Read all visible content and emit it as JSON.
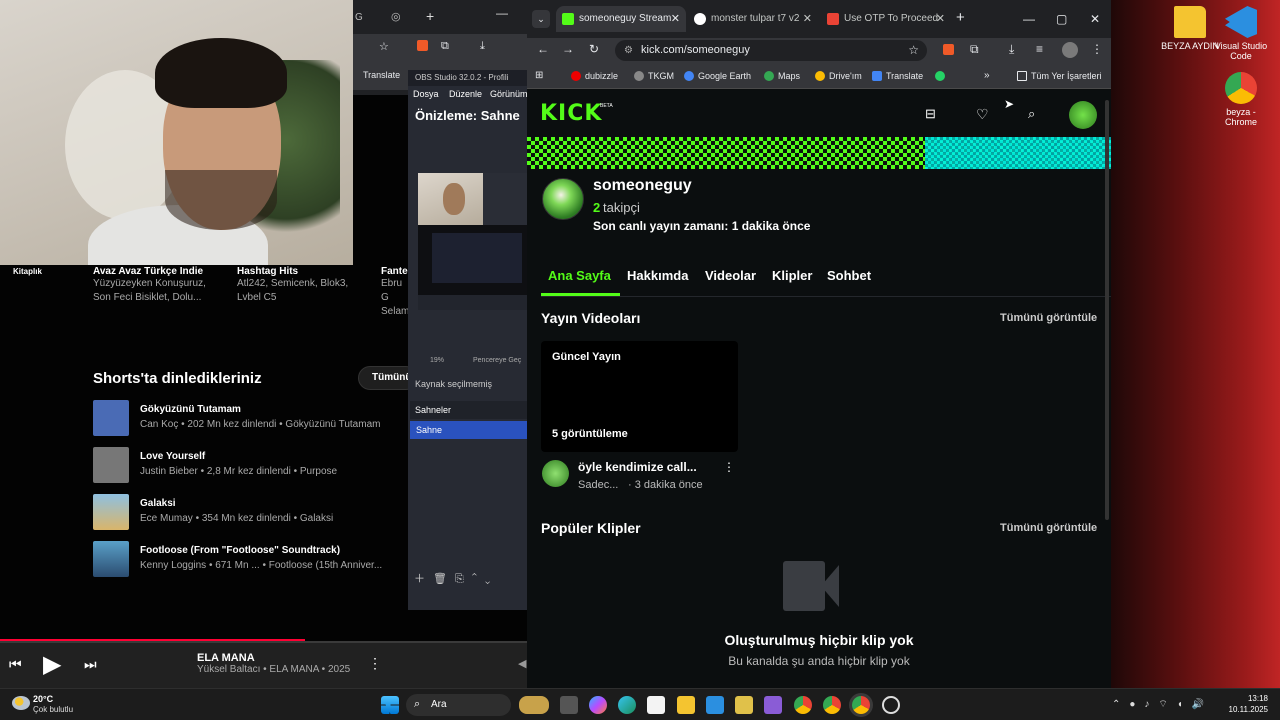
{
  "desktop": {
    "icons": [
      {
        "name": "folder",
        "label": "BEYZA AYDIN",
        "color": "#f4c430"
      },
      {
        "name": "vscode",
        "label": "Visual Studio Code",
        "color": "#2b8fe0"
      },
      {
        "name": "chrome",
        "label": "beyza - Chrome",
        "color": "#e94235"
      }
    ]
  },
  "ytmusic": {
    "albums": [
      {
        "title": "Kitaplık",
        "sub": ""
      },
      {
        "title": "Avaz Avaz Türkçe Indie",
        "sub": "Yüzyüzeyken Konuşuruz, Son Feci Bisiklet, Dolu..."
      },
      {
        "title": "Hashtag Hits",
        "sub": "Atl242, Semicenk, Blok3, Lvbel C5"
      },
      {
        "title": "Fante",
        "sub": "Ebru G Selam"
      }
    ],
    "shorts_title": "Shorts'ta dinledikleriniz",
    "shorts_more": "Tümünü",
    "songs": [
      {
        "title": "Gökyüzünü Tutamam",
        "meta": "Can Koç • 202 Mn kez dinlendi • Gökyüzünü Tutamam",
        "color": "#4a6bb5"
      },
      {
        "title": "Love Yourself",
        "meta": "Justin Bieber • 2,8 Mr kez dinlendi • Purpose",
        "color": "#777"
      },
      {
        "title": "Galaksi",
        "meta": "Ece Mumay • 354 Mn kez dinlendi • Galaksi",
        "color": "#d9b56a"
      },
      {
        "title": "Footloose (From \"Footloose\" Soundtrack)",
        "meta": "Kenny Loggins • 671 Mn ... • Footloose (15th Anniver...",
        "color": "#5aa0c8"
      }
    ],
    "player": {
      "title": "ELA MANA",
      "meta": "Yüksel Baltacı • ELA MANA • 2025",
      "progress": 0.58
    },
    "toolbar_translate": "Translate"
  },
  "obs": {
    "title": "OBS Studio 32.0.2 - Profili",
    "menu": [
      "Dosya",
      "Düzenle",
      "Görünüm"
    ],
    "preview": "Önizleme: Sahne",
    "zoom": "19%",
    "add_window": "Pencereye Geç",
    "no_source": "Kaynak seçilmemiş",
    "scenes_header": "Sahneler",
    "scene": "Sahne"
  },
  "chrome": {
    "tabs": [
      {
        "label": "someoneguy Stream",
        "color": "#53fc18",
        "active": true
      },
      {
        "label": "monster tulpar t7 v2",
        "color": "#e8eaed",
        "active": false
      },
      {
        "label": "Use OTP To Proceed",
        "color": "#ea4335",
        "active": false
      }
    ],
    "url": "kick.com/someoneguy",
    "bookmarks": [
      {
        "label": "dubizzle",
        "color": "#e00"
      },
      {
        "label": "TKGM",
        "color": "#888"
      },
      {
        "label": "Google Earth",
        "color": "#4285f4"
      },
      {
        "label": "Maps",
        "color": "#34a853"
      },
      {
        "label": "Drive'ım",
        "color": "#fbbc04"
      },
      {
        "label": "Translate",
        "color": "#4285f4"
      },
      {
        "label": "",
        "color": "#25d366"
      }
    ],
    "all_bookmarks": "Tüm Yer İşaretleri"
  },
  "kick": {
    "logo": "KICK",
    "beta": "BETA",
    "channel": {
      "name": "someoneguy",
      "followers_count": "2",
      "followers_label": "takipçi",
      "last_live": "Son canlı yayın zamanı: 1 dakika önce"
    },
    "tabs": [
      "Ana Sayfa",
      "Hakkımda",
      "Videolar",
      "Klipler",
      "Sohbet"
    ],
    "videos_title": "Yayın Videoları",
    "view_all": "Tümünü görüntüle",
    "video_card": {
      "badge": "Güncel Yayın",
      "views": "5 görüntüleme",
      "title": "öyle kendimize call...",
      "author": "Sadec...",
      "time": "· 3 dakika önce"
    },
    "clips_title": "Popüler Klipler",
    "clips_view_all": "Tümünü görüntüle",
    "empty_title": "Oluşturulmuş hiçbir klip yok",
    "empty_sub": "Bu kanalda şu anda hiçbir klip yok"
  },
  "taskbar": {
    "weather_temp": "20°C",
    "weather_desc": "Çok bulutlu",
    "search": "Ara",
    "time": "13:18",
    "date": "10.11.2025"
  }
}
